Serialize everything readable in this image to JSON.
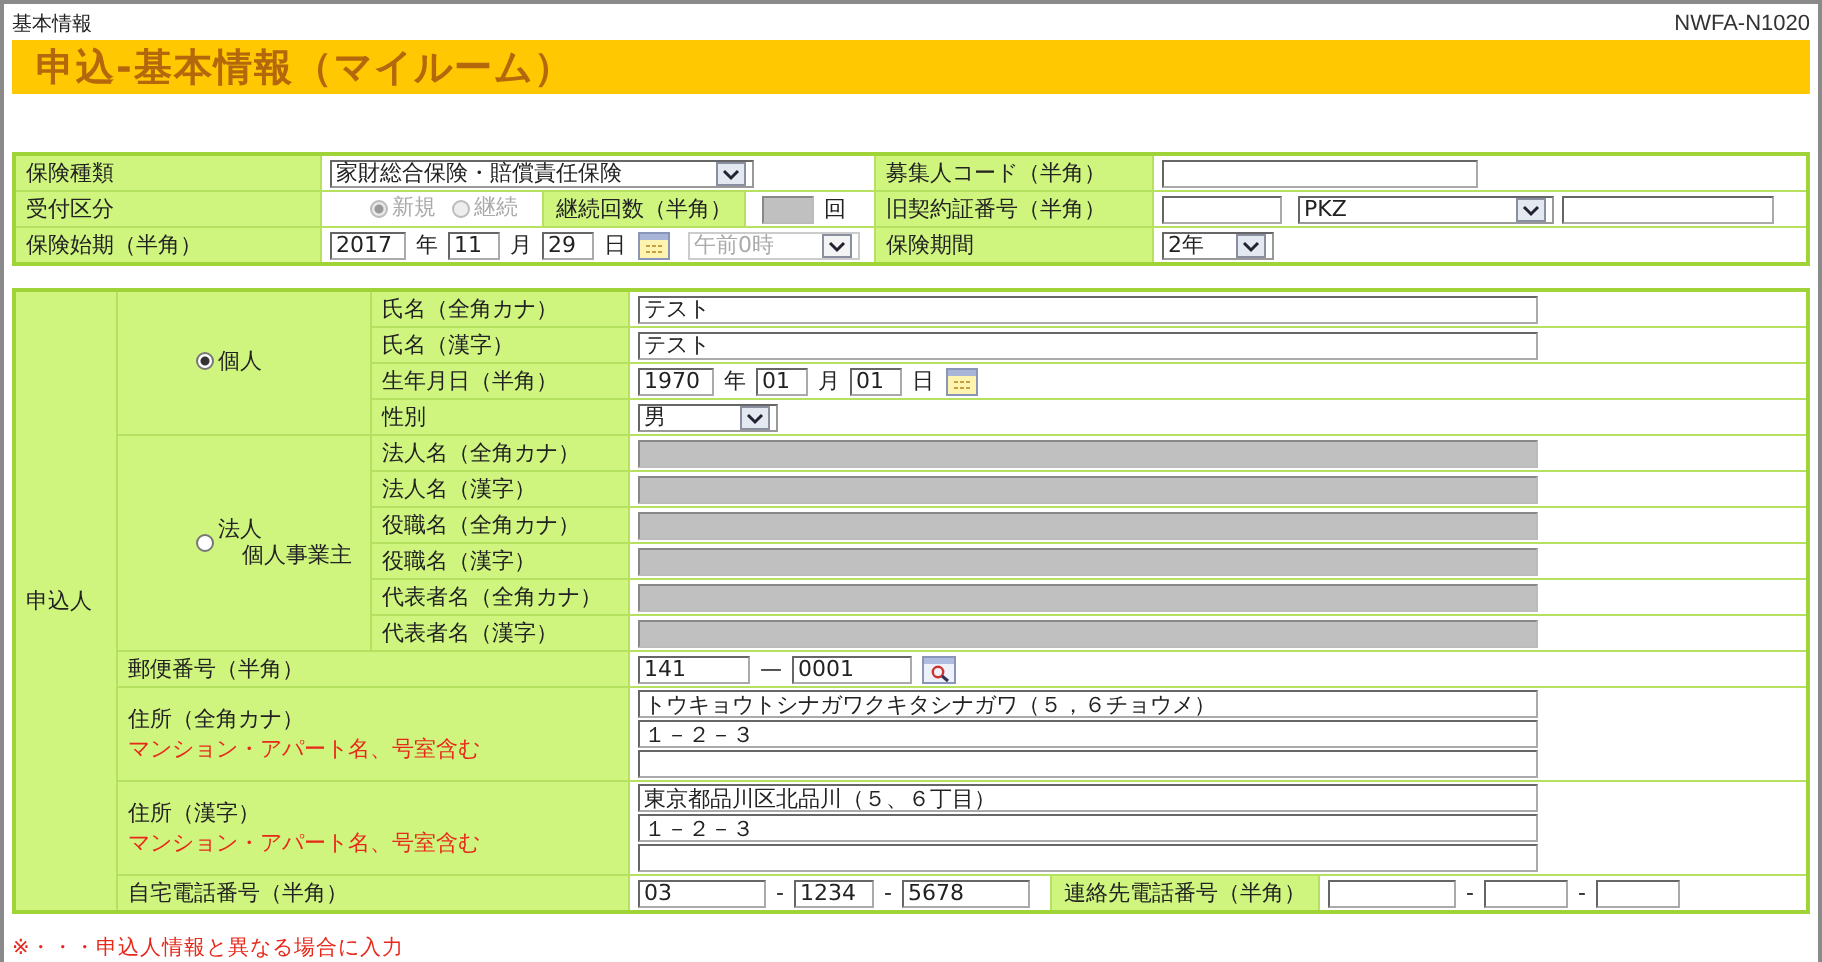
{
  "header": {
    "breadcrumb": "基本情報",
    "screen_id": "NWFA-N1020"
  },
  "title": "申込-基本情報（マイルーム）",
  "policy_form": {
    "rows": [
      {
        "cells": [
          {
            "kind": "label",
            "text": "保険種類"
          },
          {
            "kind": "value",
            "items": [
              {
                "kind": "plan_select",
                "value": "家財総合保険・賠償責任保険",
                "disabled": false
              }
            ]
          },
          {
            "kind": "label",
            "text": "募集人コード（半角）"
          },
          {
            "kind": "value",
            "items": [
              {
                "kind": "code_input",
                "disabled": false
              }
            ]
          }
        ]
      },
      {
        "cells": [
          {
            "kind": "label",
            "text": "受付区分"
          },
          {
            "kind": "value",
            "items": [
              {
                "kind": "radio",
                "label": "新規",
                "selected": true,
                "disabled": true
              },
              {
                "kind": "radio",
                "label": "継続",
                "selected": false,
                "disabled": true
              },
              {
                "kind": "label",
                "text": "継続回数（半角）"
              },
              {
                "kind": "count_input",
                "disabled": true
              },
              {
                "kind": "unit",
                "text": "回"
              }
            ]
          },
          {
            "kind": "label",
            "text": "旧契約証番号（半角）"
          },
          {
            "kind": "value",
            "items": [
              {
                "kind": "short_input",
                "disabled": false
              },
              {
                "kind": "prefix_select",
                "value": "PKZ",
                "disabled": false
              },
              {
                "kind": "mid_input",
                "disabled": false
              }
            ]
          }
        ]
      },
      {
        "cells": [
          {
            "kind": "label",
            "text": "保険始期（半角）"
          },
          {
            "kind": "value",
            "items": [
              {
                "kind": "year_input",
                "value": "2017",
                "disabled": false
              },
              {
                "kind": "unit",
                "text": "年"
              },
              {
                "kind": "two_digit_input",
                "value": "11",
                "disabled": false
              },
              {
                "kind": "unit",
                "text": "月"
              },
              {
                "kind": "two_digit_input",
                "value": "29",
                "disabled": false
              },
              {
                "kind": "unit",
                "text": "日"
              },
              {
                "kind": "calendar"
              },
              {
                "kind": "time_select",
                "value": "午前0時",
                "disabled": true
              }
            ]
          },
          {
            "kind": "label",
            "text": "保険期間"
          },
          {
            "kind": "value",
            "items": [
              {
                "kind": "period_select",
                "value": "2年",
                "disabled": false
              }
            ]
          }
        ]
      }
    ]
  },
  "applicant_form": {
    "label": "申込人",
    "groups": [
      {
        "option": {
          "lines": [
            "個人"
          ],
          "selected": true
        },
        "fields": [
          {
            "label": "氏名（全角カナ）",
            "items": [
              {
                "kind": "long_input",
                "value": "テスト",
                "disabled": false
              }
            ]
          },
          {
            "label": "氏名（漢字）",
            "items": [
              {
                "kind": "long_input",
                "value": "テスト",
                "disabled": false
              }
            ]
          },
          {
            "label": "生年月日（半角）",
            "items": [
              {
                "kind": "year_input",
                "value": "1970",
                "disabled": false
              },
              {
                "kind": "unit",
                "text": "年"
              },
              {
                "kind": "two_digit_input",
                "value": "01",
                "disabled": false
              },
              {
                "kind": "unit",
                "text": "月"
              },
              {
                "kind": "two_digit_input",
                "value": "01",
                "disabled": false
              },
              {
                "kind": "unit",
                "text": "日"
              },
              {
                "kind": "calendar"
              }
            ]
          },
          {
            "label": "性別",
            "items": [
              {
                "kind": "gender_select",
                "value": "男",
                "disabled": false
              }
            ]
          }
        ]
      },
      {
        "option": {
          "lines": [
            "法人",
            "個人事業主"
          ],
          "selected": false
        },
        "fields": [
          {
            "label": "法人名（全角カナ）",
            "items": [
              {
                "kind": "long_input",
                "disabled": true
              }
            ]
          },
          {
            "label": "法人名（漢字）",
            "items": [
              {
                "kind": "long_input",
                "disabled": true
              }
            ]
          },
          {
            "label": "役職名（全角カナ）",
            "items": [
              {
                "kind": "long_input",
                "disabled": true
              }
            ]
          },
          {
            "label": "役職名（漢字）",
            "items": [
              {
                "kind": "long_input",
                "disabled": true
              }
            ]
          },
          {
            "label": "代表者名（全角カナ）",
            "items": [
              {
                "kind": "long_input",
                "disabled": true
              }
            ]
          },
          {
            "label": "代表者名（漢字）",
            "items": [
              {
                "kind": "long_input",
                "disabled": true
              }
            ]
          }
        ]
      }
    ],
    "rows": [
      {
        "kind": "line",
        "label": "郵便番号（半角）",
        "items": [
          {
            "kind": "postal3_input",
            "value": "141",
            "disabled": false
          },
          {
            "kind": "unit",
            "text": "—"
          },
          {
            "kind": "postal4_input",
            "value": "0001",
            "disabled": false
          },
          {
            "kind": "lookup"
          }
        ]
      },
      {
        "kind": "address",
        "label": "住所（全角カナ）",
        "note": "マンション・アパート名、号室含む",
        "items": [
          {
            "kind": "long_input",
            "value": "トウキョウトシナガワクキタシナガワ（５，６チョウメ）",
            "disabled": false
          },
          {
            "kind": "long_input",
            "value": "１－２－３",
            "disabled": false
          },
          {
            "kind": "long_input",
            "disabled": false
          }
        ]
      },
      {
        "kind": "address",
        "label": "住所（漢字）",
        "note": "マンション・アパート名、号室含む",
        "items": [
          {
            "kind": "long_input",
            "value": "東京都品川区北品川（５、６丁目）",
            "disabled": false
          },
          {
            "kind": "long_input",
            "value": "１－２－３",
            "disabled": false
          },
          {
            "kind": "long_input",
            "disabled": false
          }
        ]
      },
      {
        "kind": "line",
        "label": "自宅電話番号（半角）",
        "items": [
          {
            "kind": "tel_input",
            "value": "03",
            "disabled": false
          },
          {
            "kind": "unit",
            "text": "-"
          },
          {
            "kind": "tel4_input",
            "value": "1234",
            "disabled": false
          },
          {
            "kind": "unit",
            "text": "-"
          },
          {
            "kind": "tel_input",
            "value": "5678",
            "disabled": false
          },
          {
            "kind": "label",
            "text": "連絡先電話番号（半角）"
          },
          {
            "kind": "tel_input",
            "disabled": false
          },
          {
            "kind": "unit",
            "text": "-"
          },
          {
            "kind": "tel_short_input",
            "disabled": false
          },
          {
            "kind": "unit",
            "text": "-"
          },
          {
            "kind": "tel_short_input",
            "disabled": false
          }
        ]
      }
    ]
  },
  "note": "※・・・申込人情報と異なる場合に入力"
}
